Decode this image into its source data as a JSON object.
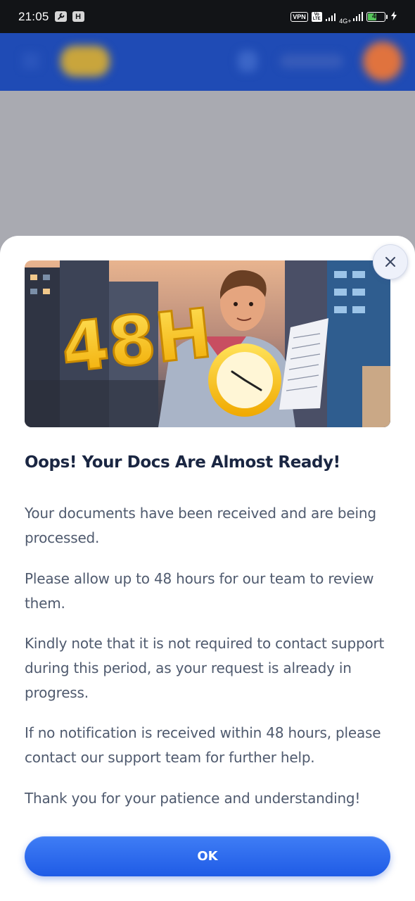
{
  "status_bar": {
    "time": "21:05",
    "notification_badge": "H",
    "vpn_label": "VPN",
    "volte_label": "Vo LTE",
    "network_label": "4G+",
    "battery_level": "46",
    "battery_fraction": 0.46
  },
  "modal": {
    "hero_text": "48H",
    "title": "Oops! Your Docs Are Almost Ready!",
    "paragraphs": [
      "Your documents have been received and are being processed.",
      "Please allow up to 48 hours for our team to review them.",
      "Kindly note that it is not required to contact support during this period, as your request is already in progress.",
      "If no notification is received within 48 hours, please contact our support team for further help.",
      "Thank you for your patience and understanding!"
    ],
    "ok_label": "OK"
  },
  "colors": {
    "primary_button": "#2a68ee",
    "title_text": "#1a2642",
    "body_text": "#4f5a6e",
    "backdrop": "#a9aab1",
    "app_header": "#1f4bb5"
  },
  "icons": {
    "close": "close-icon",
    "settings": "wrench-icon",
    "charging": "bolt-icon"
  }
}
